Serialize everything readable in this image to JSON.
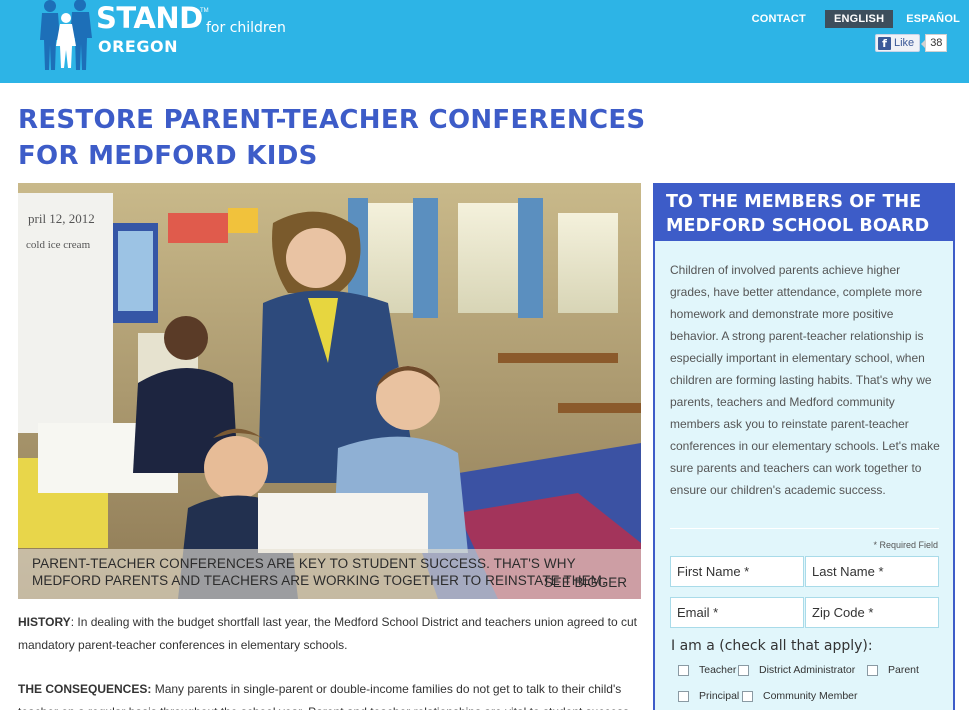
{
  "header": {
    "logo": {
      "brand": "STAND",
      "tm": "TM",
      "tagline": "for children",
      "state": "OREGON"
    },
    "nav": {
      "contact": "CONTACT",
      "english": "ENGLISH",
      "espanol": "ESPAÑOL"
    },
    "facebook": {
      "like_label": "Like",
      "count": "38",
      "logo_glyph": "f"
    },
    "colors": {
      "bar": "#2db4e6",
      "active_lang": "#3d4e5c"
    }
  },
  "main": {
    "title_line1": "RESTORE PARENT-TEACHER CONFERENCES",
    "title_line2": "FOR MEDFORD KIDS",
    "photo_caption": "PARENT-TEACHER CONFERENCES ARE KEY TO STUDENT SUCCESS. THAT'S WHY MEDFORD PARENTS AND TEACHERS ARE WORKING TOGETHER TO REINSTATE THEM.",
    "see_bigger": "SEE BIGGER",
    "history_label": "HISTORY",
    "history_text": ": In dealing with the budget shortfall last year, the Medford School District and teachers union agreed to cut mandatory parent-teacher conferences in elementary schools.",
    "consequences_label": "THE CONSEQUENCES:",
    "consequences_text": " Many parents in single-parent or double-income families do not get to talk to their child's teacher on a regular basis throughout the school year. Parent and teacher relationships are vital to student success.",
    "title_color": "#3d5cc8"
  },
  "panel": {
    "heading_line1": "TO THE MEMBERS OF THE",
    "heading_line2": "MEDFORD SCHOOL BOARD",
    "letter": "Children of involved parents achieve higher grades, have better attendance, complete more homework and demonstrate more positive behavior. A strong parent-teacher relationship is especially important in elementary school, when children are forming lasting habits. That's why we parents, teachers and Medford community members ask you to reinstate parent-teacher conferences in our elementary schools. Let's make sure parents and teachers can work together to ensure our children's academic success.",
    "required_note": "* Required Field",
    "fields": {
      "first_name": "First Name *",
      "last_name": "Last Name *",
      "email": "Email *",
      "zip": "Zip Code *"
    },
    "i_am_label": "I am a (check all that apply):",
    "checkboxes": {
      "teacher": "Teacher",
      "district_admin": "District Administrator",
      "parent": "Parent",
      "principal": "Principal",
      "community_member": "Community Member"
    },
    "colors": {
      "panel_bg": "#e1f6fb",
      "heading_bg": "#3d5cc8"
    }
  }
}
